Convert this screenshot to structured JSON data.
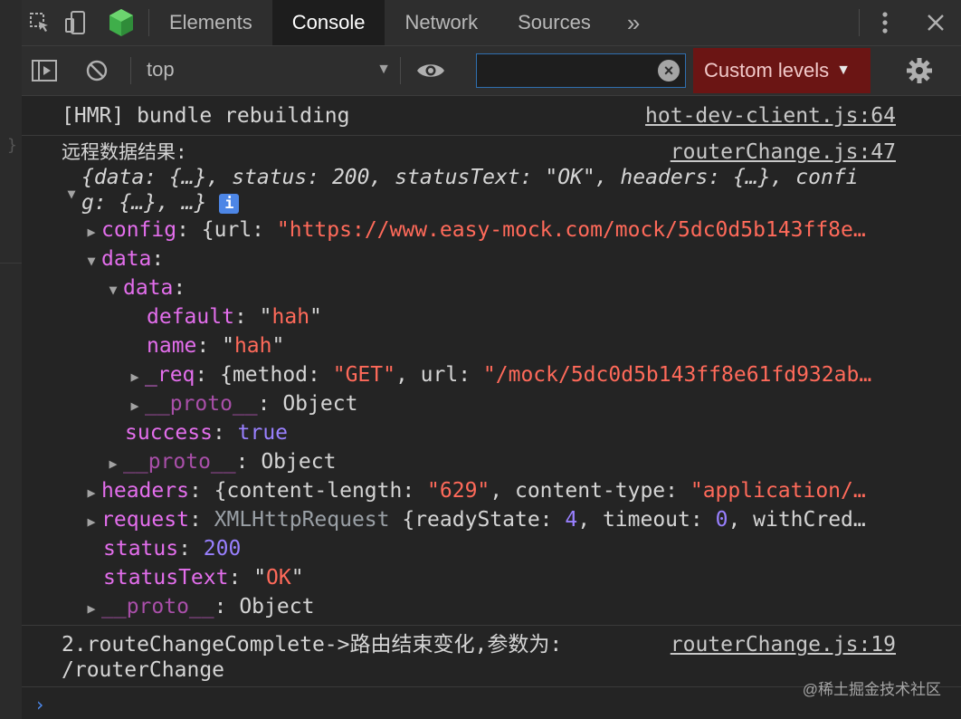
{
  "tabs": {
    "items": [
      "Elements",
      "Console",
      "Network",
      "Sources"
    ],
    "overflow": "»"
  },
  "toolbar": {
    "context": "top",
    "filter_value": "",
    "levels_label": "Custom levels"
  },
  "console": {
    "hmr_message": "[HMR] bundle rebuilding",
    "hmr_source": "hot-dev-client.js:64",
    "log_label": "远程数据结果:",
    "log_source": "routerChange.js:47",
    "summary_1": "{data: {…}, status: 200, statusText: \"OK\", headers: {…}, confi",
    "summary_2": "g: {…}, …}",
    "config_key": "config",
    "config_val_a": "{url: ",
    "config_val_b": "\"https://www.easy-mock.com/mock/5dc0d5b143ff8e…",
    "data_key": "data",
    "inner_data_key": "data",
    "default_key": "default",
    "default_val": "\"hah\"",
    "name_key": "name",
    "name_val": "\"hah\"",
    "req_key": "_req",
    "req_a": "{method: ",
    "req_b": "\"GET\"",
    "req_c": ", url: ",
    "req_d": "\"/mock/5dc0d5b143ff8e61fd932ab…",
    "proto_key": "__proto__",
    "proto_val": "Object",
    "success_key": "success",
    "success_val": "true",
    "headers_key": "headers",
    "headers_a": "{content-length: ",
    "headers_b": "\"629\"",
    "headers_c": ", content-type: ",
    "headers_d": "\"application/…",
    "request_key": "request",
    "request_a": "XMLHttpRequest",
    "request_b": " {readyState: ",
    "request_c": "4",
    "request_d": ", timeout: ",
    "request_e": "0",
    "request_f": ", withCred…",
    "status_key": "status",
    "status_val": "200",
    "statustext_key": "statusText",
    "statustext_val": "\"OK\"",
    "route_message_1": "2.routeChangeComplete->路由结束变化,参数为:",
    "route_message_2": "/routerChange",
    "route_source": "routerChange.js:19",
    "prompt": "›"
  },
  "watermark": "@稀土掘金技术社区"
}
